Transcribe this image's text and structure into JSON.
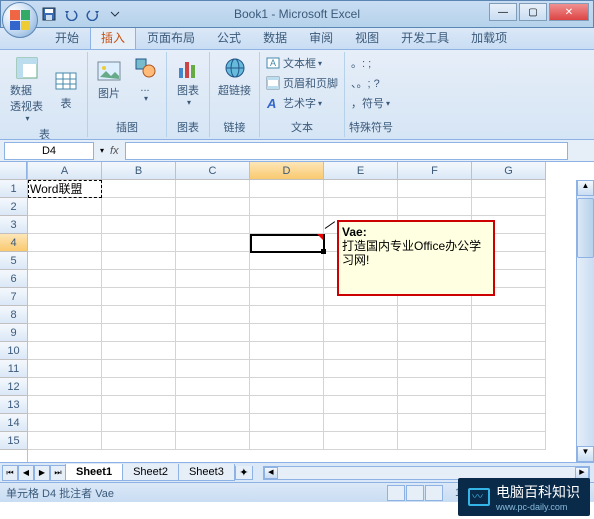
{
  "title": "Book1 - Microsoft Excel",
  "tabs": {
    "home": "开始",
    "insert": "插入",
    "layout": "页面布局",
    "formula": "公式",
    "data": "数据",
    "review": "审阅",
    "view": "视图",
    "dev": "开发工具",
    "addin": "加载项"
  },
  "ribbon": {
    "tables": {
      "pivot": "数据\n透视表",
      "table": "表",
      "label": "表"
    },
    "illustrations": {
      "picture": "图片",
      "cliparts": "...",
      "label": "插图"
    },
    "charts": {
      "chart": "图表",
      "label": "图表"
    },
    "links": {
      "hyperlink": "超链接",
      "label": "链接"
    },
    "text": {
      "textbox": "文本框",
      "headerfooter": "页眉和页脚",
      "wordart": "艺术字",
      "label": "文本"
    },
    "symbols": {
      "label": "特殊符号",
      "dotbtn": ". , .",
      "sym": "，符号"
    }
  },
  "namebox": "D4",
  "fx": "fx",
  "columns": [
    "A",
    "B",
    "C",
    "D",
    "E",
    "F",
    "G"
  ],
  "rows": [
    "1",
    "2",
    "3",
    "4",
    "5",
    "6",
    "7",
    "8",
    "9",
    "10",
    "11",
    "12",
    "13",
    "14",
    "15"
  ],
  "cellA1": "Word联盟",
  "comment": {
    "author": "Vae:",
    "body": "打造国内专业Office办公学习网!"
  },
  "sheets": {
    "s1": "Sheet1",
    "s2": "Sheet2",
    "s3": "Sheet3"
  },
  "status": "单元格 D4 批注者 Vae",
  "zoom_pct": "100%",
  "zoom_minus": "−",
  "zoom_plus": "+",
  "symb1": "。: ;",
  "symb2": "、。; ?",
  "watermark": "电脑百科知识",
  "watermark_sub": "www.pc-daily.com"
}
